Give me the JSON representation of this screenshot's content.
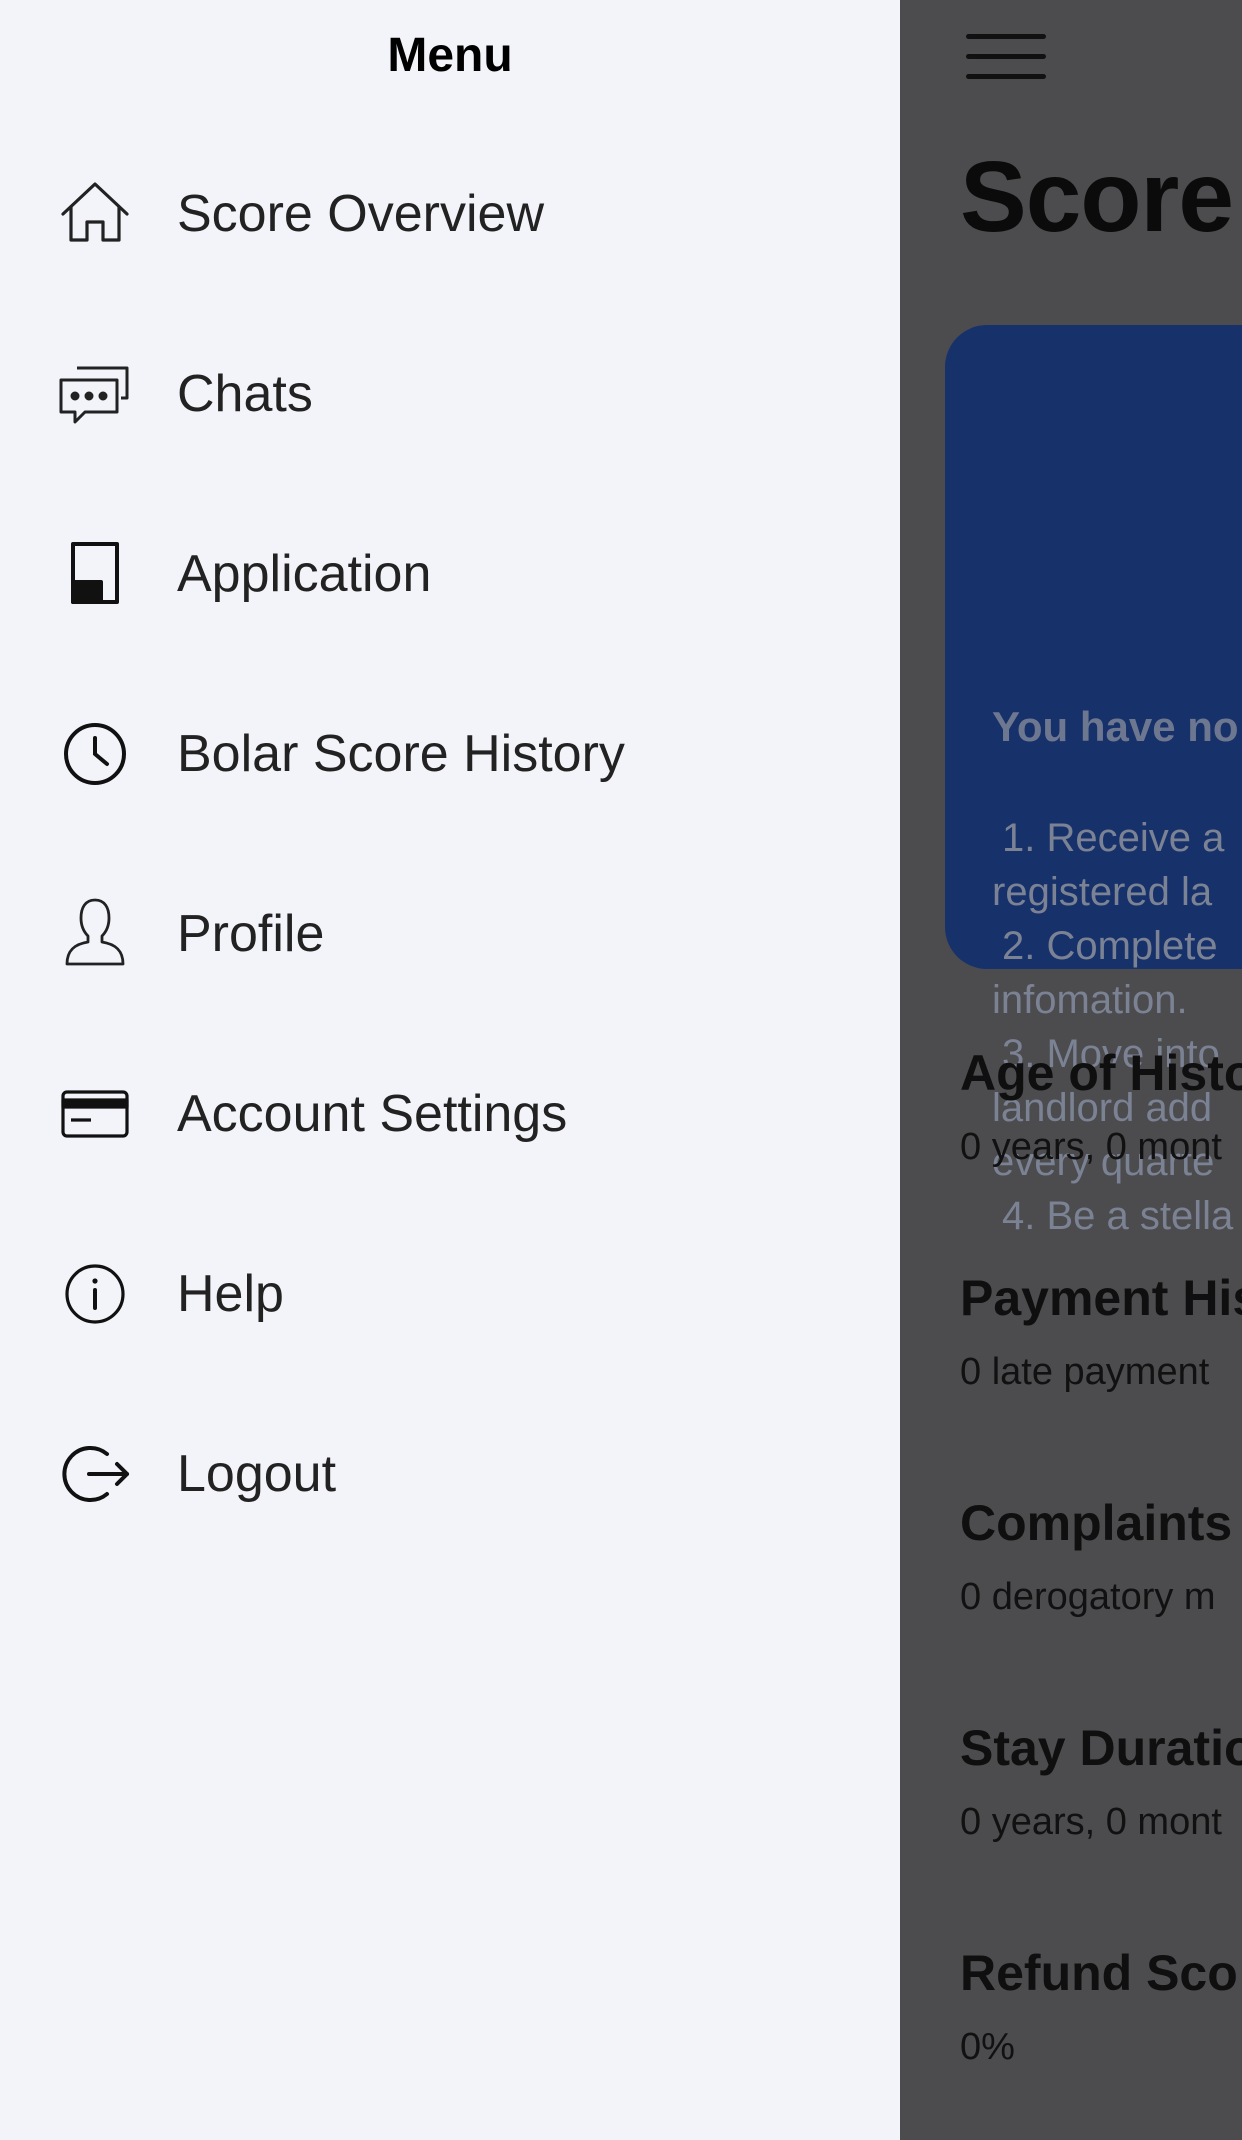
{
  "background": {
    "page_title": "Score",
    "notice": {
      "heading": "You have no",
      "steps": [
        "1. Receive a",
        "registered la",
        "2. Complete",
        "infomation.",
        "3. Move into",
        "landlord add",
        "every quarte",
        "4. Be a stella"
      ]
    },
    "stats": [
      {
        "title": "Age of Histo",
        "value": "0 years, 0 mont"
      },
      {
        "title": "Payment His",
        "value": "0 late payment"
      },
      {
        "title": "Complaints",
        "value": "0 derogatory m"
      },
      {
        "title": "Stay Duratio",
        "value": "0 years, 0 mont"
      },
      {
        "title": "Refund Sco",
        "value": "0%"
      }
    ]
  },
  "drawer": {
    "title": "Menu",
    "items": [
      {
        "label": "Score Overview",
        "icon": "home-icon"
      },
      {
        "label": "Chats",
        "icon": "chat-bubbles-icon"
      },
      {
        "label": "Application",
        "icon": "document-icon"
      },
      {
        "label": "Bolar Score History",
        "icon": "clock-icon"
      },
      {
        "label": "Profile",
        "icon": "person-icon"
      },
      {
        "label": "Account Settings",
        "icon": "credit-card-icon"
      },
      {
        "label": "Help",
        "icon": "info-icon"
      },
      {
        "label": "Logout",
        "icon": "logout-icon"
      }
    ]
  },
  "colors": {
    "drawer_bg": "#f3f4f9",
    "overlay_bg": "#4a4a4d",
    "notice_card": "#17316b"
  }
}
